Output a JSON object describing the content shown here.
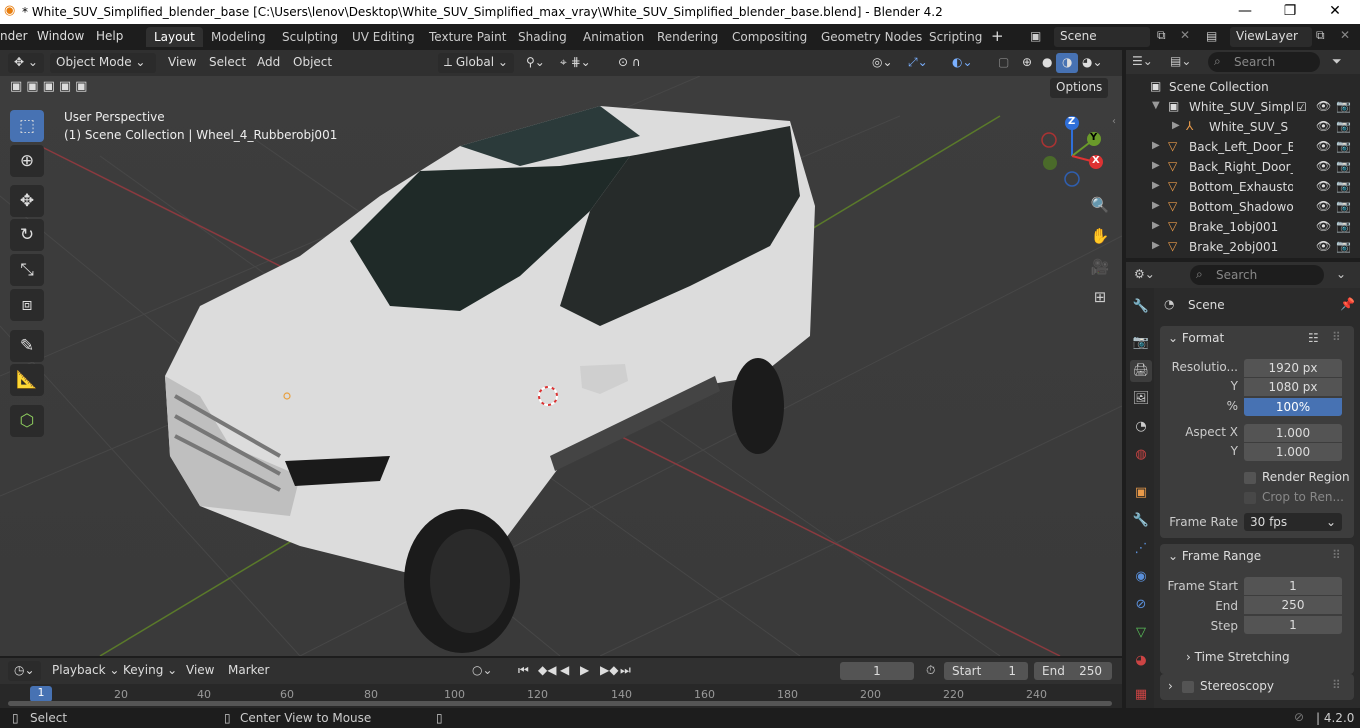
{
  "window": {
    "title": "* White_SUV_Simplified_blender_base [C:\\Users\\lenov\\Desktop\\White_SUV_Simplified_max_vray\\White_SUV_Simplified_blender_base.blend] - Blender 4.2",
    "minimize": "—",
    "maximize": "❐",
    "close": "✕"
  },
  "menu": {
    "items": [
      "nder",
      "Window",
      "Help"
    ]
  },
  "workspaces": [
    "Layout",
    "Modeling",
    "Sculpting",
    "UV Editing",
    "Texture Paint",
    "Shading",
    "Animation",
    "Rendering",
    "Compositing",
    "Geometry Nodes",
    "Scripting"
  ],
  "add_tab": "+",
  "scene": {
    "name": "Scene"
  },
  "viewlayer": {
    "name": "ViewLayer"
  },
  "viewport_header": {
    "mode": "Object Mode",
    "menus": [
      "View",
      "Select",
      "Add",
      "Object"
    ],
    "transform": "Global",
    "options": "Options"
  },
  "viewport": {
    "perspective": "User Perspective",
    "context": "(1) Scene Collection | Wheel_4_Rubberobj001",
    "axes": {
      "z": "Z",
      "y": "Y",
      "x": "X"
    }
  },
  "outliner": {
    "search_placeholder": "Search",
    "root": "Scene Collection",
    "rows": [
      "White_SUV_Simplif",
      "White_SUV_Sin",
      "Back_Left_Door_Bo",
      "Back_Right_Door_B",
      "Bottom_Exhaustob",
      "Bottom_Shadowob",
      "Brake_1obj001",
      "Brake_2obj001"
    ]
  },
  "properties": {
    "search_placeholder": "Search",
    "context": "Scene",
    "format": {
      "title": "Format",
      "res_label": "Resolutio...",
      "res_x": "1920 px",
      "y_label": "Y",
      "res_y": "1080 px",
      "pct_label": "%",
      "pct": "100%",
      "aspect_label": "Aspect X",
      "aspect_x": "1.000",
      "aspect_y_label": "Y",
      "aspect_y": "1.000",
      "render_region": "Render Region",
      "crop": "Crop to Ren...",
      "fps_label": "Frame Rate",
      "fps": "30 fps"
    },
    "frame_range": {
      "title": "Frame Range",
      "start_label": "Frame Start",
      "start": "1",
      "end_label": "End",
      "end": "250",
      "step_label": "Step",
      "step": "1"
    },
    "time_stretching": "Time Stretching",
    "stereoscopy": "Stereoscopy"
  },
  "timeline": {
    "menus": [
      "Playback",
      "Keying",
      "View",
      "Marker"
    ],
    "current": "1",
    "start_label": "Start",
    "start": "1",
    "end_label": "End",
    "end": "250",
    "ticks": [
      "1",
      "20",
      "40",
      "60",
      "80",
      "100",
      "120",
      "140",
      "160",
      "180",
      "200",
      "220",
      "240"
    ]
  },
  "status": {
    "select": "Select",
    "center": "Center View to Mouse",
    "version": "4.2.0"
  }
}
